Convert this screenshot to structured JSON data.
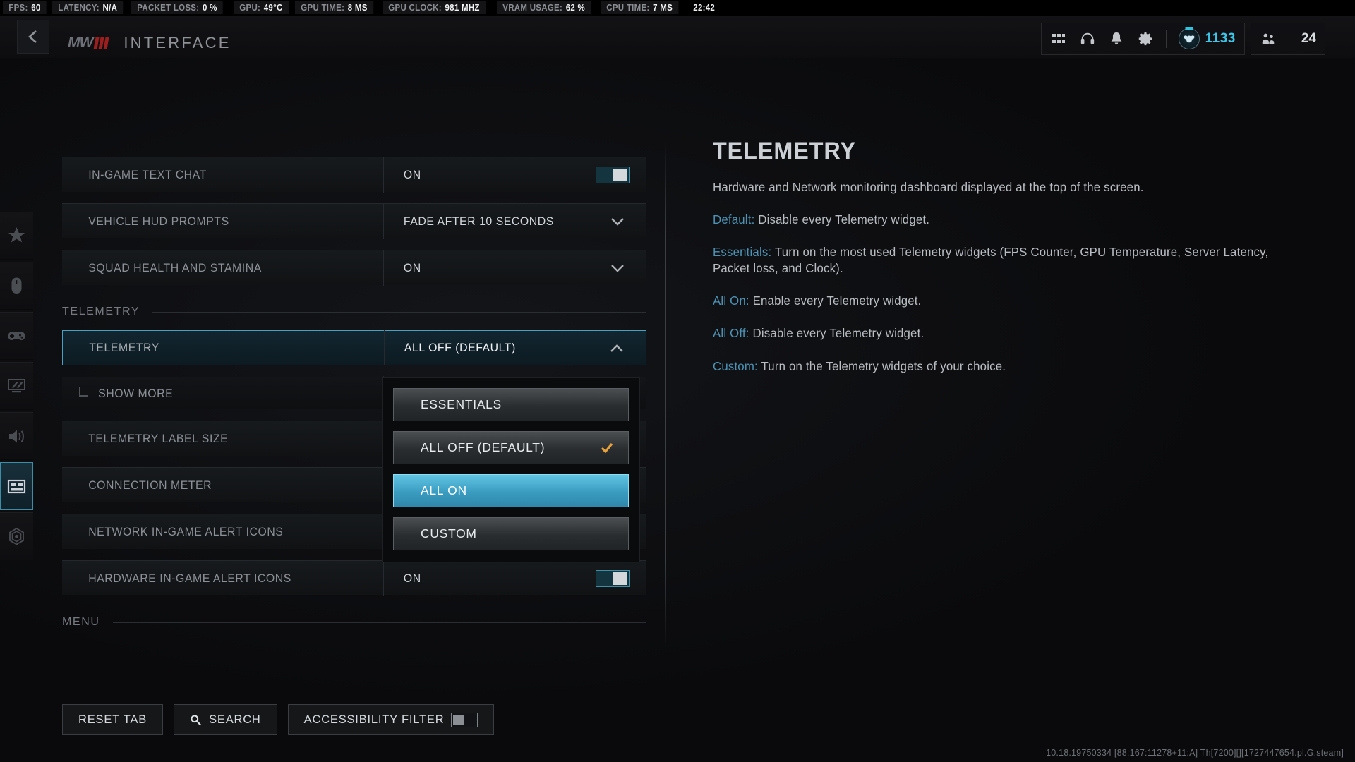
{
  "telemetry_bar": {
    "items": [
      {
        "label": "FPS:",
        "value": "60"
      },
      {
        "label": "LATENCY:",
        "value": "N/A"
      },
      {
        "label": "PACKET LOSS:",
        "value": "0 %"
      },
      {
        "label": "GPU:",
        "value": "49°C"
      },
      {
        "label": "GPU TIME:",
        "value": "8 MS"
      },
      {
        "label": "GPU CLOCK:",
        "value": "981 MHZ"
      },
      {
        "label": "VRAM USAGE:",
        "value": "62 %"
      },
      {
        "label": "CPU TIME:",
        "value": "7 MS"
      }
    ],
    "clock": "22:42"
  },
  "header": {
    "back_icon": "chevron-left-icon",
    "logo_text": "MW",
    "title": "INTERFACE",
    "icons": [
      {
        "name": "grid-icon"
      },
      {
        "name": "headphones-icon"
      },
      {
        "name": "bell-icon"
      },
      {
        "name": "gear-icon"
      }
    ],
    "level": "1133",
    "squad_count": "24"
  },
  "sidebar": {
    "items": [
      {
        "name": "sidebar-item-favorites",
        "icon": "star-icon",
        "active": false
      },
      {
        "name": "sidebar-item-mouse-keyboard",
        "icon": "mouse-icon",
        "active": false
      },
      {
        "name": "sidebar-item-controller",
        "icon": "gamepad-icon",
        "active": false
      },
      {
        "name": "sidebar-item-graphics",
        "icon": "monitor-icon",
        "active": false
      },
      {
        "name": "sidebar-item-audio",
        "icon": "speaker-icon",
        "active": false
      },
      {
        "name": "sidebar-item-interface",
        "icon": "interface-layout-icon",
        "active": true
      },
      {
        "name": "sidebar-item-account",
        "icon": "radar-icon",
        "active": false
      }
    ]
  },
  "settings": {
    "rows_top": [
      {
        "label": "IN-GAME TEXT CHAT",
        "value": "ON",
        "control": "toggle",
        "toggle_on": true
      },
      {
        "label": "VEHICLE HUD PROMPTS",
        "value": "FADE AFTER 10 SECONDS",
        "control": "dropdown"
      },
      {
        "label": "SQUAD HEALTH AND STAMINA",
        "value": "ON",
        "control": "dropdown"
      }
    ],
    "section_telemetry": "TELEMETRY",
    "rows_telemetry": [
      {
        "label": "TELEMETRY",
        "value": "ALL OFF (DEFAULT)",
        "control": "dropdown-open",
        "highlighted": true
      },
      {
        "label": "SHOW MORE",
        "value": "",
        "control": "sub",
        "sub": true
      },
      {
        "label": "TELEMETRY LABEL SIZE",
        "value": "",
        "control": "none"
      },
      {
        "label": "CONNECTION METER",
        "value": "",
        "control": "none"
      },
      {
        "label": "NETWORK IN-GAME ALERT ICONS",
        "value": "",
        "control": "none"
      },
      {
        "label": "HARDWARE IN-GAME ALERT ICONS",
        "value": "ON",
        "control": "toggle",
        "toggle_on": true
      }
    ],
    "section_menu": "MENU"
  },
  "dropdown": {
    "options": [
      {
        "label": "ESSENTIALS",
        "selected": false,
        "checked": false
      },
      {
        "label": "ALL OFF (DEFAULT)",
        "selected": false,
        "checked": true
      },
      {
        "label": "ALL ON",
        "selected": true,
        "checked": false
      },
      {
        "label": "CUSTOM",
        "selected": false,
        "checked": false
      }
    ]
  },
  "detail": {
    "title": "TELEMETRY",
    "intro": "Hardware and Network monitoring dashboard displayed at the top of the screen.",
    "entries": [
      {
        "term": "Default:",
        "text": " Disable every Telemetry widget."
      },
      {
        "term": "Essentials:",
        "text": " Turn on the most used Telemetry widgets (FPS Counter, GPU Temperature, Server Latency, Packet loss, and Clock)."
      },
      {
        "term": "All On:",
        "text": " Enable every Telemetry widget."
      },
      {
        "term": "All Off:",
        "text": " Disable every Telemetry widget."
      },
      {
        "term": "Custom:",
        "text": " Turn on the Telemetry widgets of your choice."
      }
    ]
  },
  "bottom": {
    "reset_label": "RESET TAB",
    "search_label": "SEARCH",
    "accessibility_label": "ACCESSIBILITY FILTER",
    "accessibility_on": false
  },
  "build_string": "10.18.19750334 [88:167:11278+11:A] Th[7200][][1727447654.pl.G.steam]",
  "colors": {
    "accent_cyan": "#3ec6e8",
    "highlight_blue": "#3a9cc0",
    "check_orange": "#e8a23c",
    "brand_red": "#9b1f1f",
    "link_blue": "#4d93b5"
  }
}
